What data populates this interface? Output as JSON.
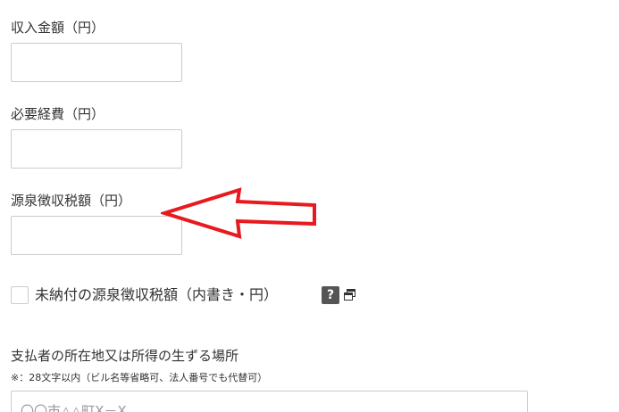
{
  "form": {
    "income": {
      "label": "収入金額（円）",
      "value": ""
    },
    "expenses": {
      "label": "必要経費（円）",
      "value": ""
    },
    "withholding": {
      "label": "源泉徴収税額（円）",
      "value": ""
    },
    "unpaid_withholding": {
      "label": "未納付の源泉徴収税額（内書き・円）",
      "checked": false,
      "help_icon": "question-mark-icon",
      "help_label": "?",
      "popup_icon": "open-window-icon"
    },
    "payer_address": {
      "label": "支払者の所在地又は所得の生ずる場所",
      "note": "※：28文字以内（ビル名等省略可、法人番号でも代替可）",
      "placeholder": "〇〇市△△町X－X"
    }
  },
  "annotation": {
    "icon": "left-arrow-icon",
    "color": "#e8191f"
  }
}
